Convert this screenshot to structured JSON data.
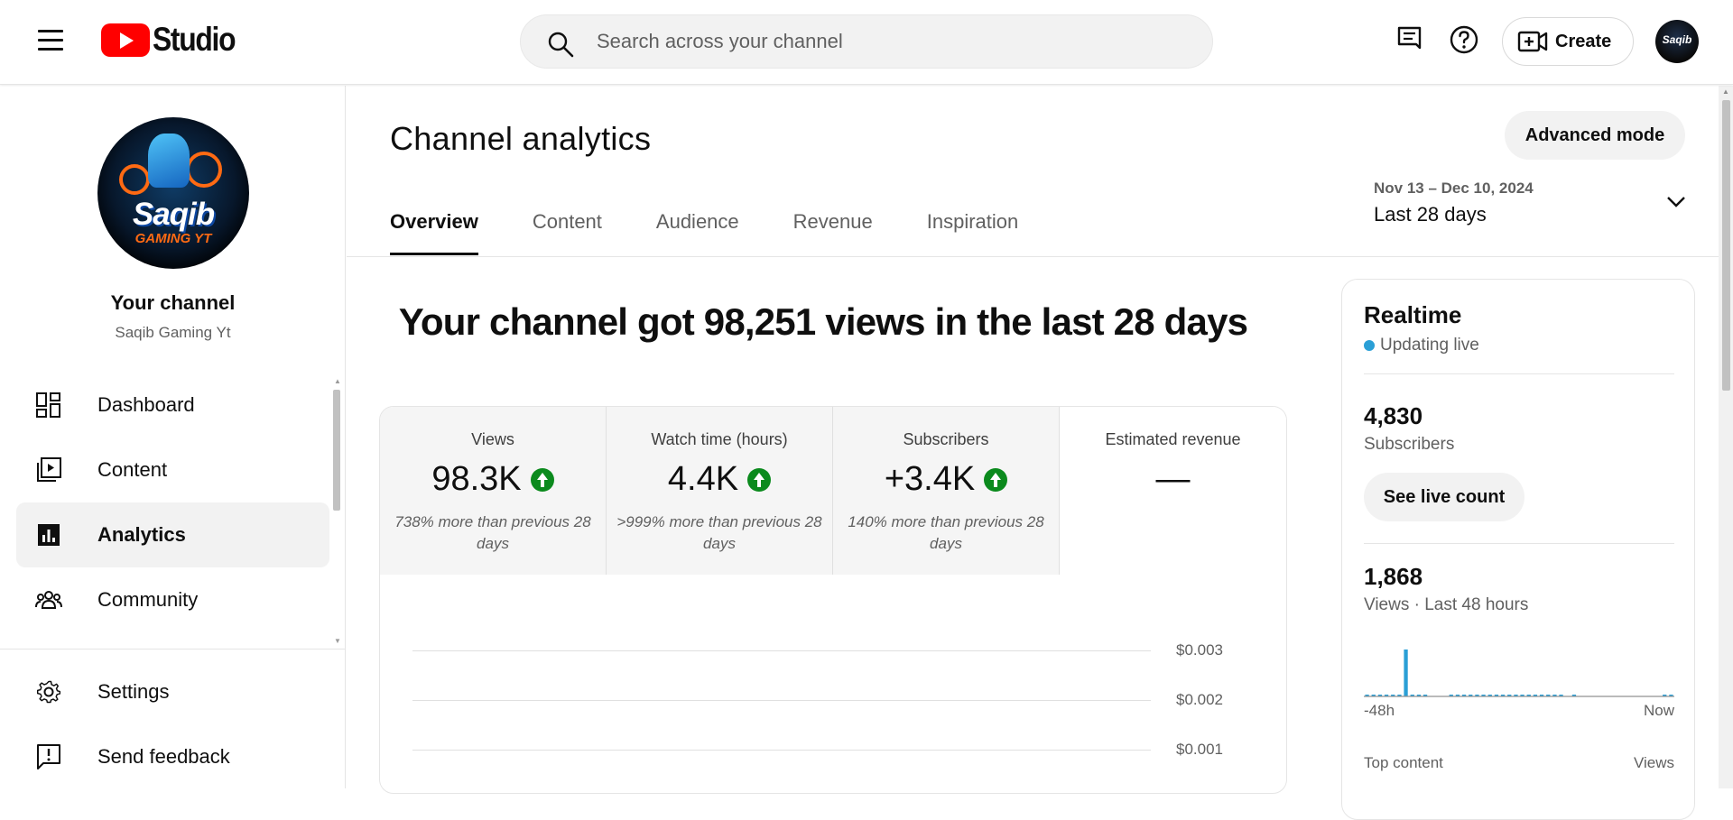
{
  "header": {
    "logo_text": "Studio",
    "search_placeholder": "Search across your channel",
    "create_label": "Create",
    "avatar_text": "Saqib"
  },
  "sidebar": {
    "channel_logo_name": "Saqib",
    "channel_logo_sub": "GAMING YT",
    "your_channel": "Your channel",
    "channel_name": "Saqib Gaming Yt",
    "items": [
      {
        "label": "Dashboard",
        "icon": "dashboard-icon"
      },
      {
        "label": "Content",
        "icon": "content-icon"
      },
      {
        "label": "Analytics",
        "icon": "analytics-icon",
        "active": true
      },
      {
        "label": "Community",
        "icon": "community-icon"
      }
    ],
    "bottom_items": [
      {
        "label": "Settings",
        "icon": "gear-icon"
      },
      {
        "label": "Send feedback",
        "icon": "feedback-icon"
      }
    ]
  },
  "main": {
    "title": "Channel analytics",
    "advanced_mode": "Advanced mode",
    "tabs": [
      "Overview",
      "Content",
      "Audience",
      "Revenue",
      "Inspiration"
    ],
    "active_tab": "Overview",
    "date_range": {
      "dates": "Nov 13 – Dec 10, 2024",
      "label": "Last 28 days"
    },
    "headline": "Your channel got 98,251 views in the last 28 days",
    "metrics": [
      {
        "label": "Views",
        "value": "98.3K",
        "trend": "up",
        "note": "738% more than previous 28 days"
      },
      {
        "label": "Watch time (hours)",
        "value": "4.4K",
        "trend": "up",
        "note": ">999% more than previous 28 days"
      },
      {
        "label": "Subscribers",
        "value": "+3.4K",
        "trend": "up",
        "note": "140% more than previous 28 days"
      },
      {
        "label": "Estimated revenue",
        "value": "—",
        "trend": "none",
        "note": ""
      }
    ],
    "chart_gridlines": [
      "$0.003",
      "$0.002",
      "$0.001"
    ]
  },
  "realtime": {
    "title": "Realtime",
    "status": "Updating live",
    "subscribers_value": "4,830",
    "subscribers_label": "Subscribers",
    "live_count_button": "See live count",
    "views_value": "1,868",
    "views_label": "Views · Last 48 hours",
    "axis_start": "-48h",
    "axis_end": "Now",
    "top_content_label": "Top content",
    "top_content_metric": "Views",
    "accent_color": "#2a9fd6"
  },
  "chart_data": {
    "type": "bar",
    "title": "",
    "xlabel": "",
    "ylabel": "Views",
    "x_range": [
      "-48h",
      "Now"
    ],
    "note": "hourly views over the last 48 hours; a single tall spike near -45h, small bars elsewhere",
    "values": [
      2,
      1,
      1,
      2,
      1,
      1,
      90,
      3,
      1,
      1,
      0,
      0,
      0,
      1,
      2,
      1,
      2,
      1,
      2,
      1,
      1,
      2,
      2,
      2,
      2,
      1,
      2,
      2,
      1,
      2,
      1,
      0,
      1,
      0,
      0,
      0,
      0,
      0,
      0,
      0,
      0,
      0,
      0,
      0,
      0,
      0,
      1,
      2
    ]
  }
}
